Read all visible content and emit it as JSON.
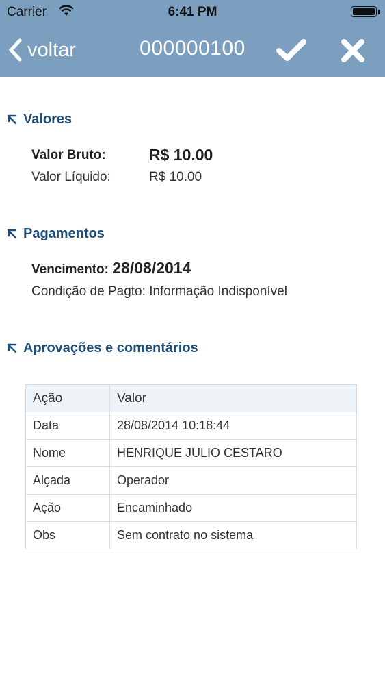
{
  "status_bar": {
    "carrier": "Carrier",
    "time": "6:41 PM",
    "wifi_icon": "wifi-icon",
    "battery_icon": "battery-icon"
  },
  "navbar": {
    "back_label": "voltar",
    "title": "000000100",
    "confirm_icon": "checkmark-icon",
    "close_icon": "close-icon",
    "bg_color": "#7c9fc0"
  },
  "sections": {
    "valores": {
      "title": "Valores",
      "valor_bruto_label": "Valor Bruto:",
      "valor_bruto_value": "R$ 10.00",
      "valor_liquido_label": "Valor Líquido:",
      "valor_liquido_value": "R$ 10.00"
    },
    "pagamentos": {
      "title": "Pagamentos",
      "vencimento_label": "Vencimento:",
      "vencimento_value": "28/08/2014",
      "condicao_label": "Condição de Pagto:",
      "condicao_value": "Informação Indisponível"
    },
    "aprovacoes": {
      "title": "Aprovações e comentários",
      "table": {
        "headers": [
          "Ação",
          "Valor"
        ],
        "rows": [
          [
            "Data",
            "28/08/2014 10:18:44"
          ],
          [
            "Nome",
            "HENRIQUE JULIO CESTARO"
          ],
          [
            "Alçada",
            "Operador"
          ],
          [
            "Ação",
            "Encaminhado"
          ],
          [
            "Obs",
            "Sem contrato no sistema"
          ]
        ]
      }
    }
  },
  "colors": {
    "section_title": "#1f4e79",
    "table_border": "#d5dde6",
    "table_header_bg": "#eef3f8"
  }
}
